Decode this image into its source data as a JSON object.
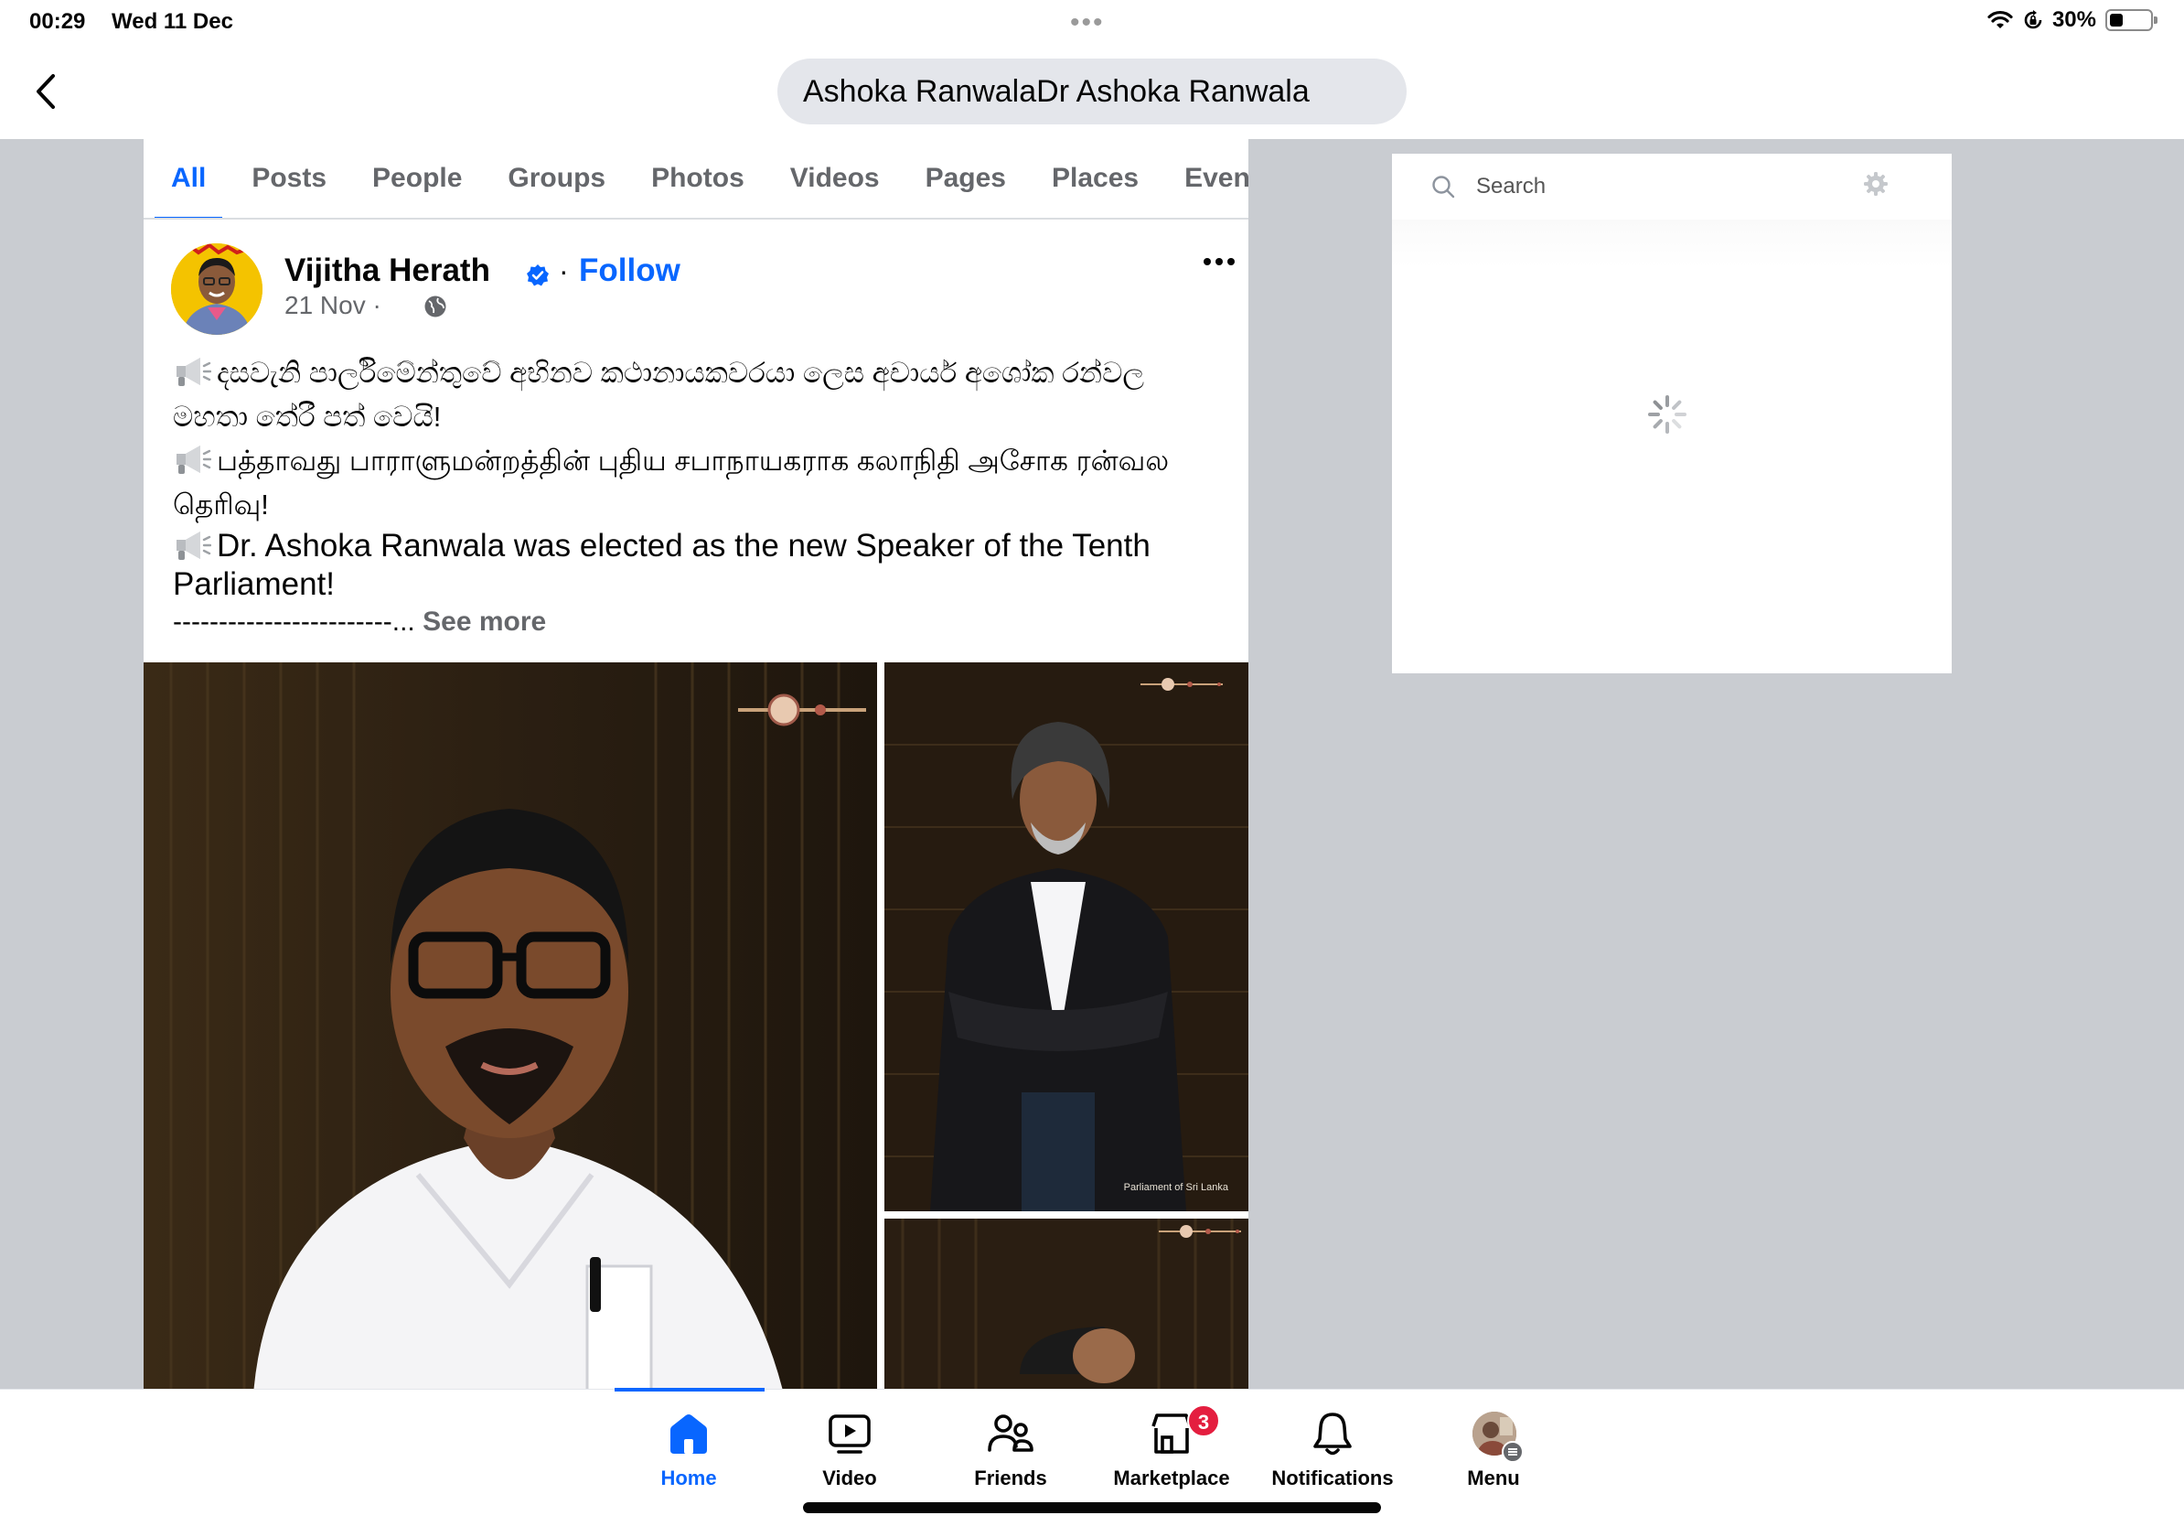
{
  "status_bar": {
    "time": "00:29",
    "date": "Wed 11 Dec",
    "battery_text": "30%",
    "battery_level": 0.3
  },
  "header": {
    "search_query": "Ashoka RanwalaDr Ashoka Ranwala"
  },
  "tabs": [
    {
      "label": "All",
      "active": true
    },
    {
      "label": "Posts",
      "active": false
    },
    {
      "label": "People",
      "active": false
    },
    {
      "label": "Groups",
      "active": false
    },
    {
      "label": "Photos",
      "active": false
    },
    {
      "label": "Videos",
      "active": false
    },
    {
      "label": "Pages",
      "active": false
    },
    {
      "label": "Places",
      "active": false
    },
    {
      "label": "Event",
      "active": false
    }
  ],
  "post": {
    "author": "Vijitha Herath",
    "separator": "·",
    "follow_label": "Follow",
    "date": "21 Nov ·",
    "lines": {
      "sinhala": "දසවැනි පාර්ලිමේන්තුවේ අභිනව කථානායකවරයා ලෙස අචාර්ය අශෝක රන්වල මහතා තේරී පත් වෙයි!",
      "tamil": "பத்தாவது பாராளுமன்றத்தின் புதிய சபாநாயகராக கலாநிதி அசோக ரன்வல தெரிவு!",
      "english": "Dr. Ashoka Ranwala was elected as the new Speaker of the Tenth Parliament!"
    },
    "dash_line": "------------------------...",
    "see_more": "See more",
    "photo_caption": "Parliament of Sri Lanka"
  },
  "right_panel": {
    "search_placeholder": "Search"
  },
  "bottom_nav": {
    "home": "Home",
    "video": "Video",
    "friends": "Friends",
    "marketplace": "Marketplace",
    "marketplace_badge": "3",
    "notifications": "Notifications",
    "menu": "Menu"
  },
  "colors": {
    "accent": "#0866ff",
    "badge": "#e41e3f",
    "page_bg": "#c9ccd1",
    "muted_text": "#65676b"
  },
  "icons": [
    "back-chevron-icon",
    "wifi-icon",
    "screen-lock-icon",
    "battery-icon",
    "verified-badge-icon",
    "globe-icon",
    "more-icon",
    "megaphone-icon",
    "search-icon",
    "gear-icon",
    "spinner-icon",
    "home-icon",
    "video-icon",
    "friends-icon",
    "marketplace-icon",
    "notifications-icon"
  ]
}
